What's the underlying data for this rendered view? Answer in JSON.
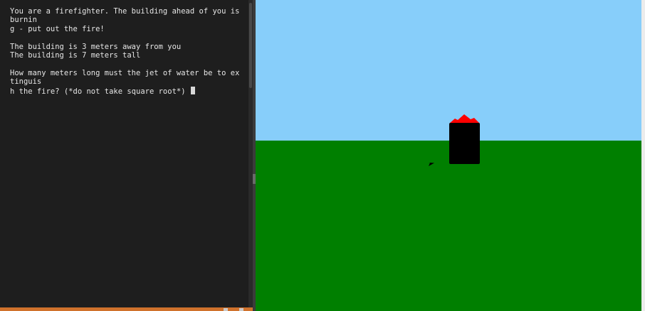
{
  "console": {
    "lines": [
      "You are a firefighter. The building ahead of you is burnin",
      "g - put out the fire!",
      "",
      "The building is 3 meters away from you",
      "The building is 7 meters tall",
      "",
      "How many meters long must the jet of water be to extinguis",
      "h the fire? (*do not take square root*) "
    ]
  },
  "scene": {
    "sky_color": "#87cefa",
    "ground_color": "#007f00",
    "building_color": "#000000",
    "fire_color": "#ff0000",
    "turtle_color": "#000000",
    "turtle_icon": "arrow-cursor-icon"
  }
}
